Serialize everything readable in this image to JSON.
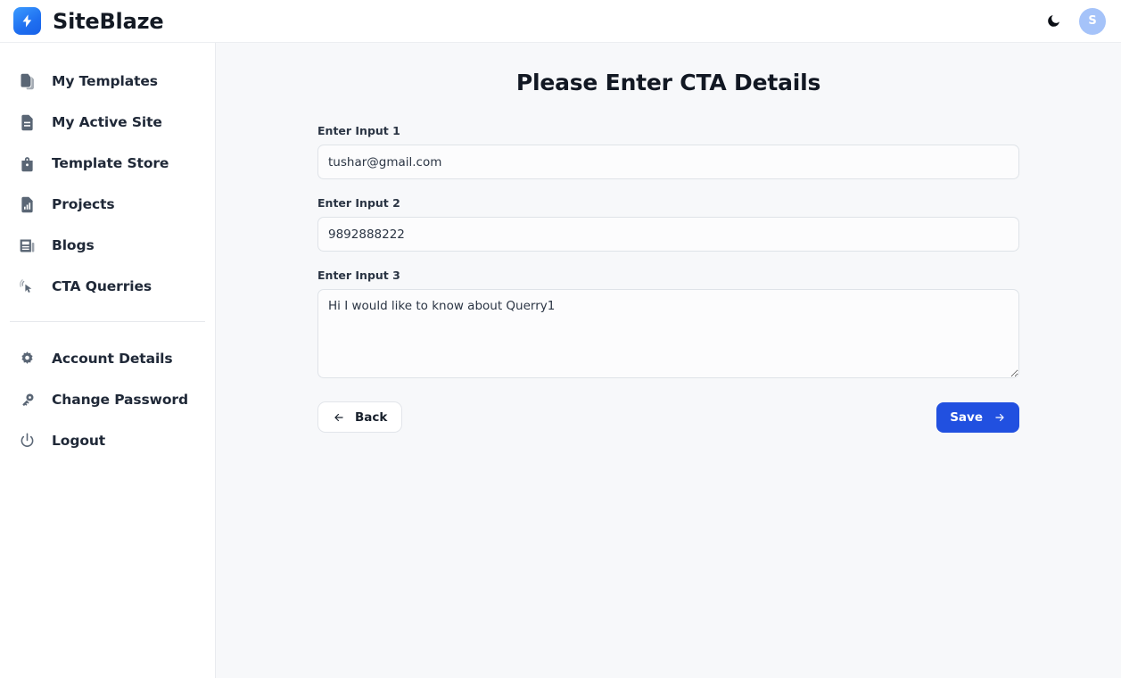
{
  "header": {
    "brand_name": "SiteBlaze",
    "logo_icon": "lightning-bolt-icon",
    "theme_toggle_icon": "moon-icon",
    "avatar_initial": "S",
    "brand_color": "#1f6ff0",
    "avatar_color": "#a5c3f9"
  },
  "sidebar": {
    "primary_items": [
      {
        "label": "My Templates",
        "icon": "templates-copy-icon"
      },
      {
        "label": "My Active Site",
        "icon": "document-icon"
      },
      {
        "label": "Template Store",
        "icon": "lock-bag-icon"
      },
      {
        "label": "Projects",
        "icon": "bar-chart-document-icon"
      },
      {
        "label": "Blogs",
        "icon": "newspaper-icon"
      },
      {
        "label": "CTA Querries",
        "icon": "click-pointer-icon"
      }
    ],
    "secondary_items": [
      {
        "label": "Account Details",
        "icon": "gear-icon"
      },
      {
        "label": "Change Password",
        "icon": "key-icon"
      },
      {
        "label": "Logout",
        "icon": "power-icon"
      }
    ]
  },
  "main": {
    "title": "Please Enter CTA Details",
    "fields": [
      {
        "label": "Enter Input 1",
        "value": "tushar@gmail.com",
        "placeholder": "",
        "type": "text"
      },
      {
        "label": "Enter Input 2",
        "value": "9892888222",
        "placeholder": "",
        "type": "text"
      },
      {
        "label": "Enter Input 3",
        "value": "Hi I would like to know about Querry1",
        "placeholder": "",
        "type": "textarea"
      }
    ],
    "back_button": "Back",
    "save_button": "Save",
    "back_icon": "arrow-left-icon",
    "save_icon": "arrow-right-icon",
    "save_button_color": "#2150e0"
  }
}
